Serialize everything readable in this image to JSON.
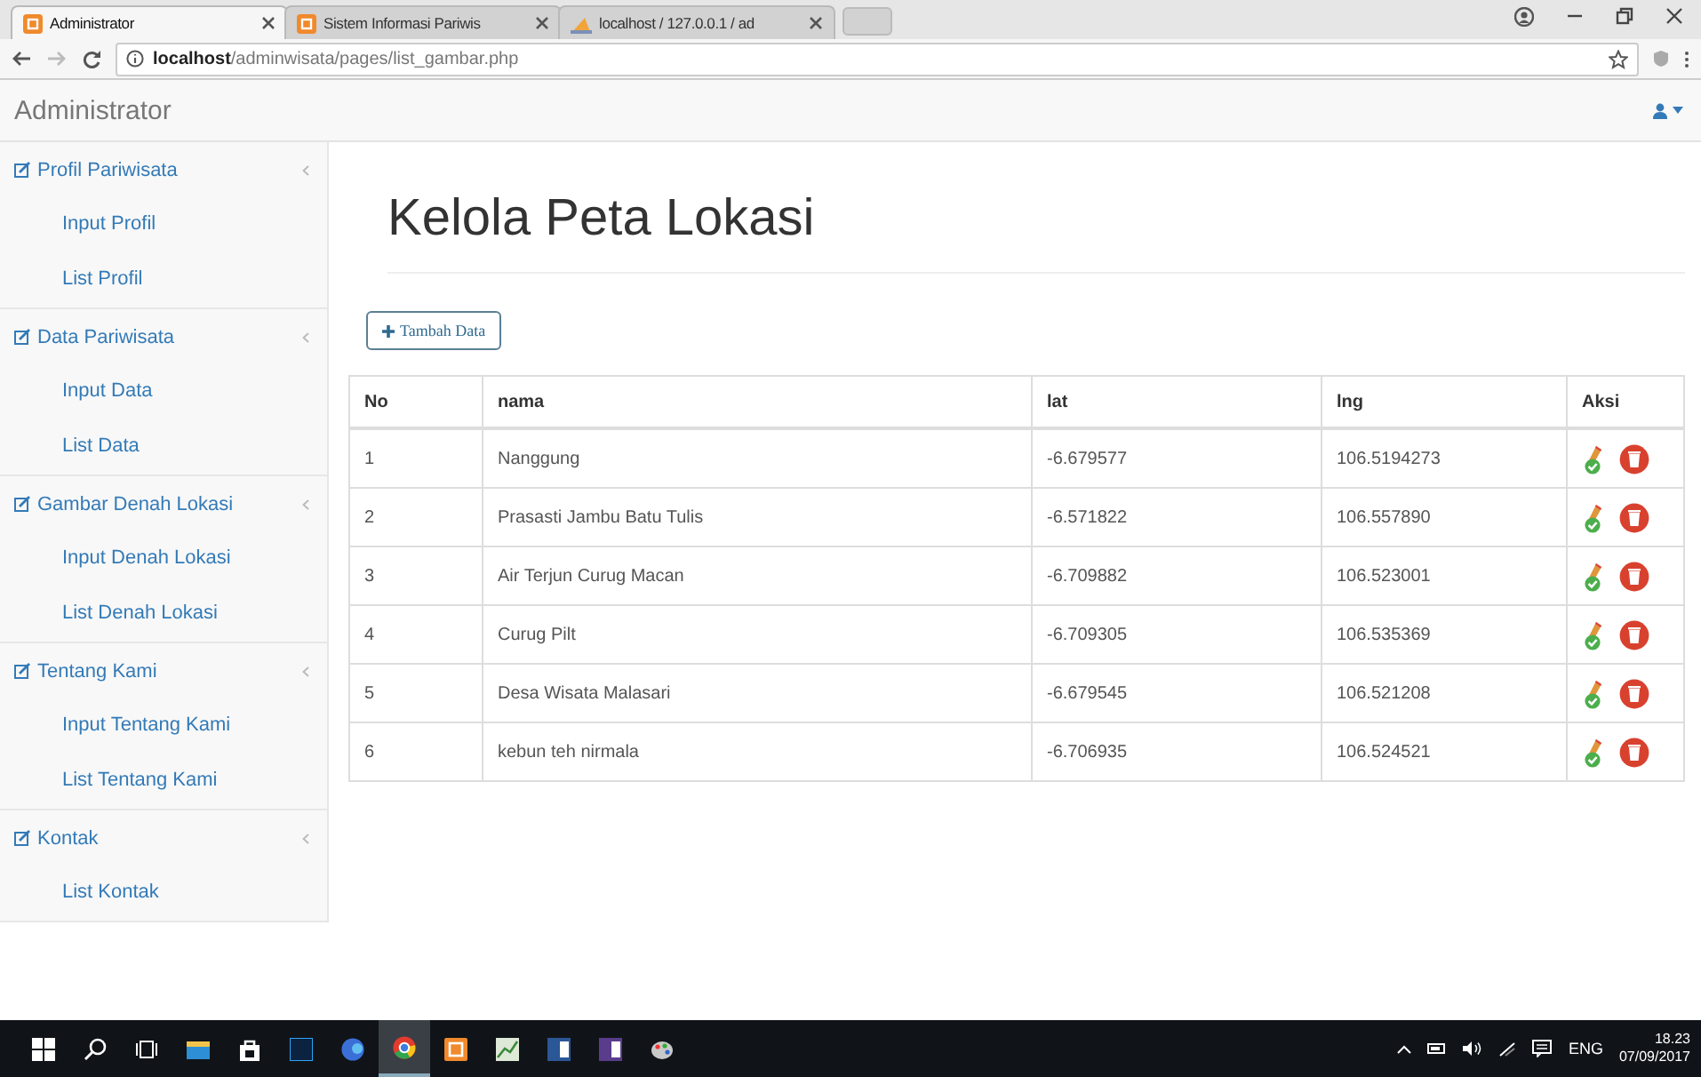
{
  "browser": {
    "tabs": [
      {
        "title": "Administrator",
        "selected": true
      },
      {
        "title": "Sistem Informasi Pariwis",
        "selected": false
      },
      {
        "title": "localhost / 127.0.0.1 / ad",
        "selected": false
      }
    ],
    "address": "**localhost**/adminwisata/pages/list_gambar.php"
  },
  "navbar": {
    "brand": "Administrator"
  },
  "sidebar": {
    "groups": [
      {
        "title": "Profil Pariwisata",
        "children": [
          {
            "label": "Input Profil"
          },
          {
            "label": "List Profil"
          }
        ]
      },
      {
        "title": "Data Pariwisata",
        "children": [
          {
            "label": "Input Data"
          },
          {
            "label": "List Data"
          }
        ]
      },
      {
        "title": "Gambar Denah Lokasi",
        "children": [
          {
            "label": "Input Denah Lokasi"
          },
          {
            "label": "List Denah Lokasi"
          }
        ]
      },
      {
        "title": "Tentang Kami",
        "children": [
          {
            "label": "Input Tentang Kami"
          },
          {
            "label": "List Tentang Kami"
          }
        ]
      },
      {
        "title": "Kontak",
        "children": [
          {
            "label": "List Kontak"
          }
        ]
      }
    ]
  },
  "content": {
    "heading": "Kelola Peta Lokasi",
    "add_button": "Tambah Data",
    "table": {
      "columns": [
        "No",
        "nama",
        "lat",
        "lng",
        "Aksi"
      ],
      "rows": [
        [
          "1",
          "Nanggung",
          "-6.679577",
          "106.5194273"
        ],
        [
          "2",
          "Prasasti Jambu Batu Tulis",
          "-6.571822",
          "106.557890"
        ],
        [
          "3",
          "Air Terjun Curug Macan",
          "-6.709882",
          "106.523001"
        ],
        [
          "4",
          "Curug Pilt",
          "-6.709305",
          "106.535369"
        ],
        [
          "5",
          "Desa Wisata Malasari",
          "-6.679545",
          "106.521208"
        ],
        [
          "6",
          "kebun teh nirmala",
          "-6.706935",
          "106.524521"
        ]
      ]
    }
  },
  "taskbar": {
    "language": "ENG",
    "time": "18.23",
    "date": "07/09/2017"
  }
}
